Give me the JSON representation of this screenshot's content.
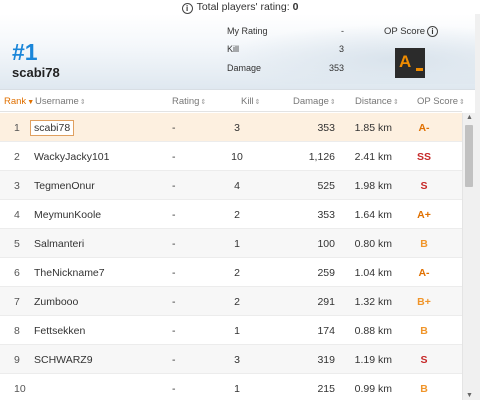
{
  "top": {
    "label": "Total players' rating:",
    "value": "0"
  },
  "profile": {
    "rank": "#1",
    "name": "scabi78",
    "my_rating_label": "My Rating",
    "my_rating_value": "-",
    "kill_label": "Kill",
    "kill_value": "3",
    "damage_label": "Damage",
    "damage_value": "353",
    "op_score_label": "OP Score",
    "op_score_badge": "A"
  },
  "columns": {
    "rank": "Rank",
    "username": "Username",
    "rating": "Rating",
    "kill": "Kill",
    "damage": "Damage",
    "distance": "Distance",
    "op_score": "OP Score"
  },
  "rows": [
    {
      "rank": "1",
      "username": "scabi78",
      "rating": "-",
      "kill": "3",
      "damage": "353",
      "distance": "1.85 km",
      "op": "A-",
      "op_color": "#e07000"
    },
    {
      "rank": "2",
      "username": "WackyJacky101",
      "rating": "-",
      "kill": "10",
      "damage": "1,126",
      "distance": "2.41 km",
      "op": "SS",
      "op_color": "#c62828"
    },
    {
      "rank": "3",
      "username": "TegmenOnur",
      "rating": "-",
      "kill": "4",
      "damage": "525",
      "distance": "1.98 km",
      "op": "S",
      "op_color": "#c62828"
    },
    {
      "rank": "4",
      "username": "MeymunKoole",
      "rating": "-",
      "kill": "2",
      "damage": "353",
      "distance": "1.64 km",
      "op": "A+",
      "op_color": "#e07000"
    },
    {
      "rank": "5",
      "username": "Salmanteri",
      "rating": "-",
      "kill": "1",
      "damage": "100",
      "distance": "0.80 km",
      "op": "B",
      "op_color": "#f0952a"
    },
    {
      "rank": "6",
      "username": "TheNickname7",
      "rating": "-",
      "kill": "2",
      "damage": "259",
      "distance": "1.04 km",
      "op": "A-",
      "op_color": "#e07000"
    },
    {
      "rank": "7",
      "username": "Zumbooo",
      "rating": "-",
      "kill": "2",
      "damage": "291",
      "distance": "1.32 km",
      "op": "B+",
      "op_color": "#f0952a"
    },
    {
      "rank": "8",
      "username": "Fettsekken",
      "rating": "-",
      "kill": "1",
      "damage": "174",
      "distance": "0.88 km",
      "op": "B",
      "op_color": "#f0952a"
    },
    {
      "rank": "9",
      "username": "SCHWARZ9",
      "rating": "-",
      "kill": "3",
      "damage": "319",
      "distance": "1.19 km",
      "op": "S",
      "op_color": "#c62828"
    },
    {
      "rank": "10",
      "username": "",
      "rating": "-",
      "kill": "1",
      "damage": "215",
      "distance": "0.99 km",
      "op": "B",
      "op_color": "#f0952a"
    }
  ],
  "colors": {
    "accent": "#1a86d9",
    "highlight_row": "#fdf0e0",
    "rank_header": "#e07000"
  },
  "icons": {
    "info": "info-icon",
    "sort": "sort-arrows-icon",
    "op_badge": "op-score-badge-icon"
  }
}
